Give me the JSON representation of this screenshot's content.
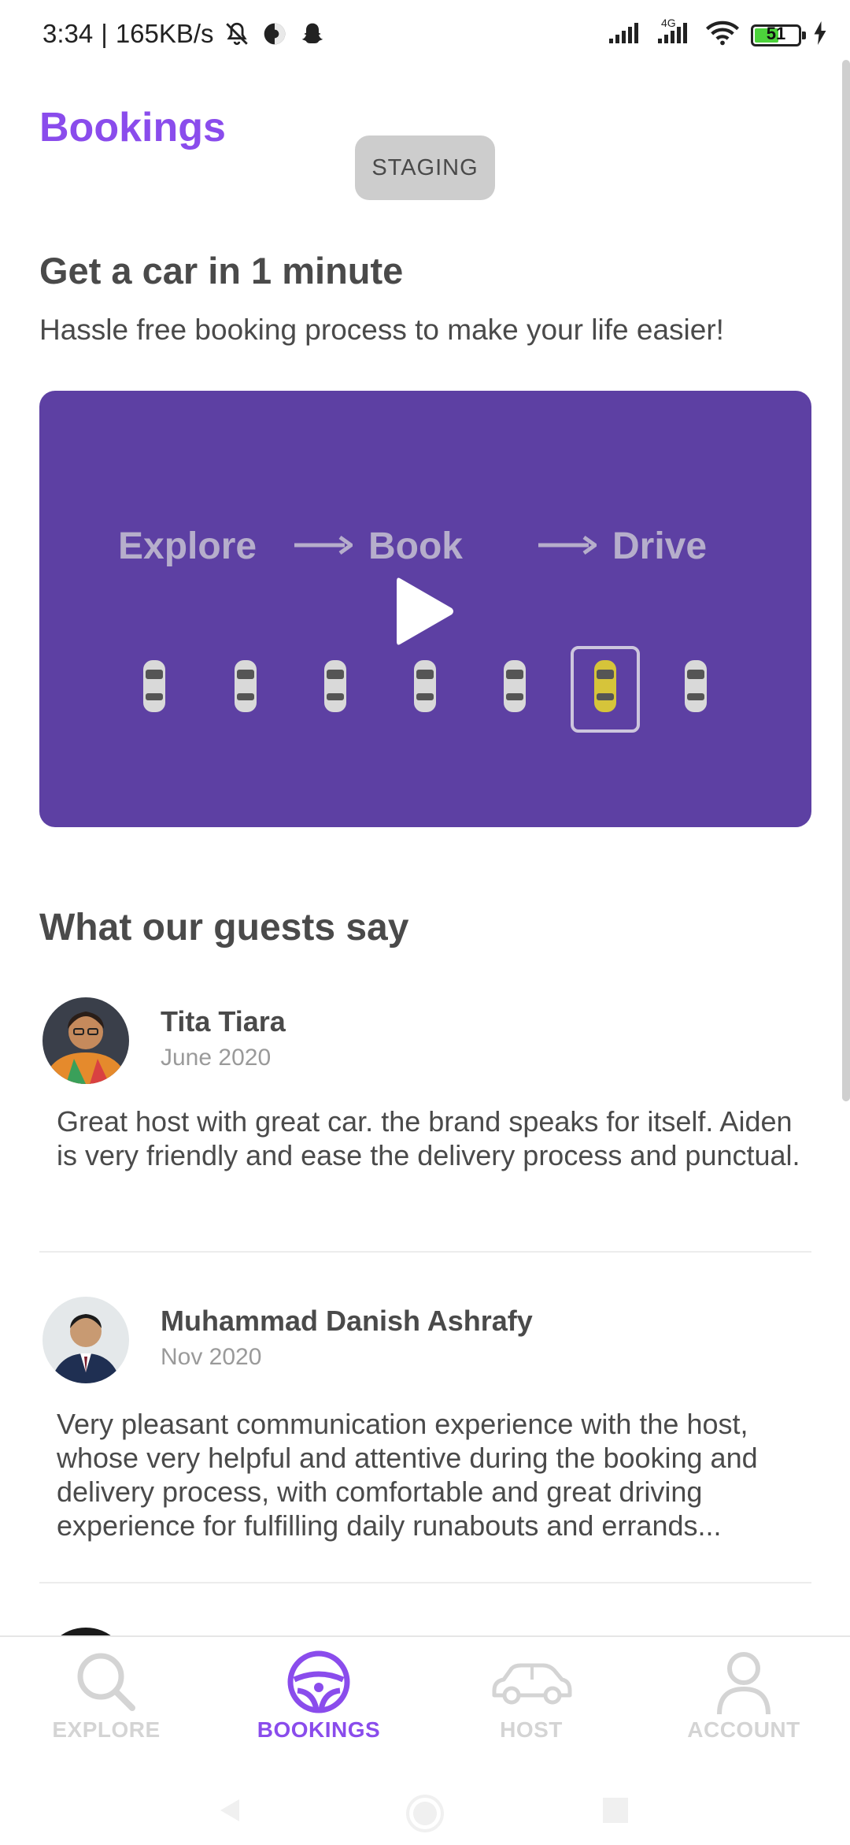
{
  "status_bar": {
    "time": "3:34",
    "network_speed": "165KB/s",
    "separator": "|",
    "icons": [
      "mute-icon",
      "data-saver-icon",
      "snapchat-icon",
      "signal-icon",
      "signal-4g-icon",
      "wifi-icon",
      "charging-icon"
    ],
    "network_type": "4G",
    "battery": "51",
    "battery_color": "#4cd33b"
  },
  "header": {
    "title": "Bookings",
    "badge": "STAGING"
  },
  "hero": {
    "title": "Get a car in 1 minute",
    "subtitle": "Hassle free booking process to make your life easier!"
  },
  "video": {
    "background": "#5d40a3",
    "steps": [
      "Explore",
      "Book",
      "Drive"
    ],
    "icon": "play-icon"
  },
  "reviews_section": {
    "title": "What our guests say",
    "reviews": [
      {
        "name": "Tita Tiara",
        "date": "June 2020",
        "text": "Great host with great car. the brand speaks for itself. Aiden is very friendly and ease the delivery process and punctual."
      },
      {
        "name": "Muhammad Danish Ashrafy",
        "date": "Nov 2020",
        "text": "Very pleasant communication experience with the host, whose very helpful and attentive during the booking and delivery process, with comfortable and great driving experience for fulfilling daily runabouts and errands..."
      }
    ]
  },
  "bottom_nav": {
    "active_color": "#8a4cec",
    "inactive_color": "#d4d4d4",
    "items": [
      {
        "label": "EXPLORE",
        "icon": "search-icon",
        "active": false
      },
      {
        "label": "BOOKINGS",
        "icon": "steering-wheel-icon",
        "active": true
      },
      {
        "label": "HOST",
        "icon": "car-icon",
        "active": false
      },
      {
        "label": "ACCOUNT",
        "icon": "user-icon",
        "active": false
      }
    ]
  }
}
